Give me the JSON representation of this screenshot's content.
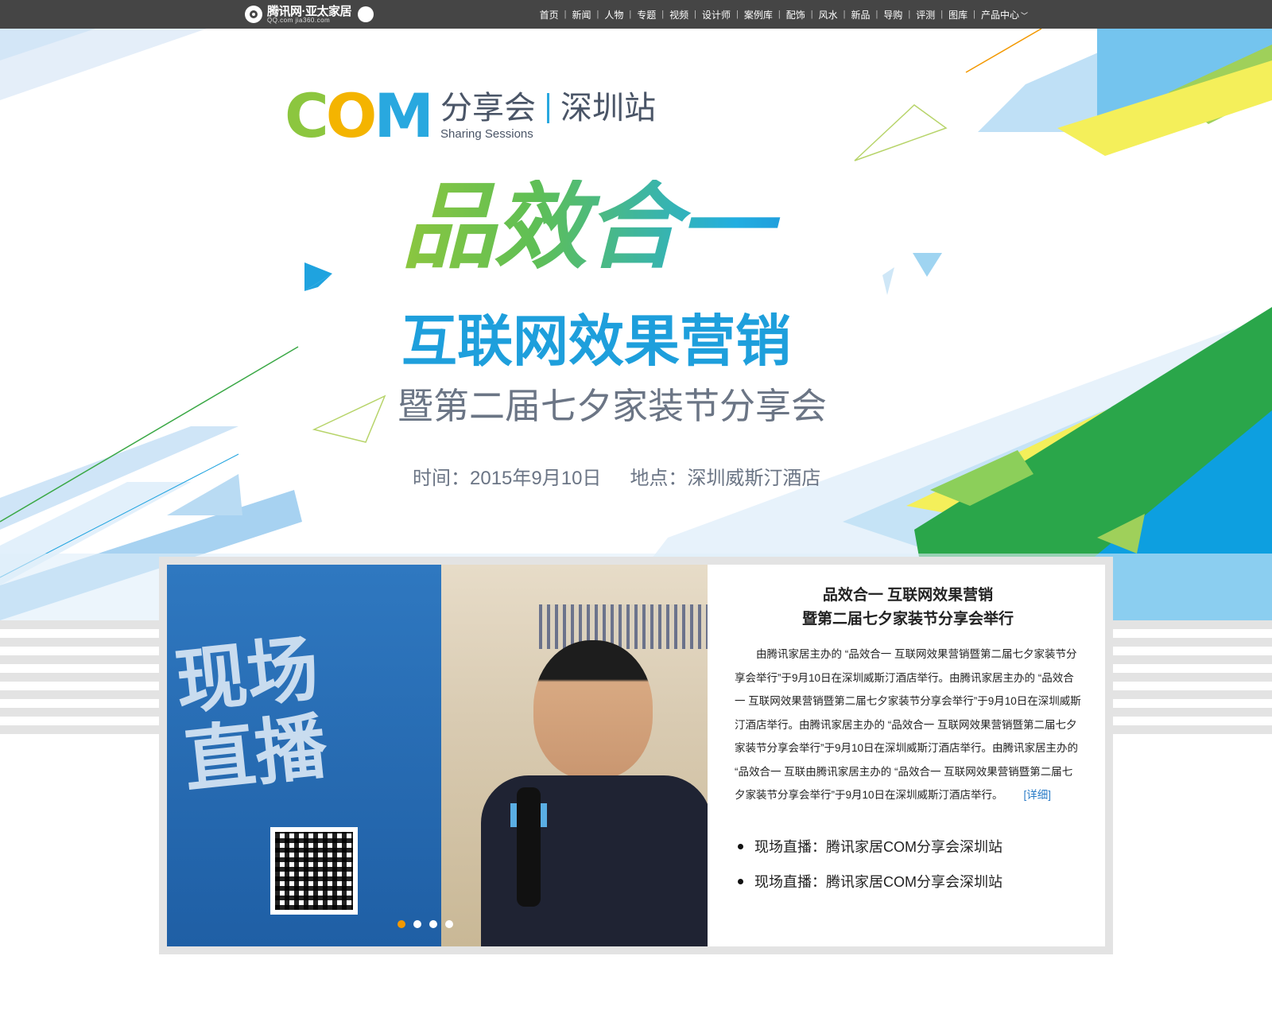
{
  "topbar": {
    "logo_main": "腾讯网·亚太家居",
    "logo_sub": "QQ.com  jia360.com",
    "nav": [
      "首页",
      "新闻",
      "人物",
      "专题",
      "视频",
      "设计师",
      "案例库",
      "配饰",
      "风水",
      "新品",
      "导购",
      "评测",
      "图库",
      "产品中心"
    ],
    "caret": "﹀"
  },
  "banner": {
    "com_letters": [
      "C",
      "O",
      "M"
    ],
    "com_title": "分享会",
    "com_city": "深圳站",
    "com_subtitle": "Sharing Sessions",
    "headline": "品效合一",
    "headline2": "互联网效果营销",
    "headline3": "暨第二届七夕家装节分享会",
    "time": "时间：2015年9月10日",
    "place": "地点：深圳威斯汀酒店"
  },
  "photo": {
    "panel_text_1": "现场",
    "panel_text_2": "直播",
    "dots": 4,
    "active_dot": 0
  },
  "article": {
    "title_line1": "品效合一 互联网效果营销",
    "title_line2": "暨第二届七夕家装节分享会举行",
    "body": "由腾讯家居主办的 “品效合一 互联网效果营销暨第二届七夕家装节分享会举行”于9月10日在深圳威斯汀酒店举行。由腾讯家居主办的 “品效合一 互联网效果营销暨第二届七夕家装节分享会举行”于9月10日在深圳威斯汀酒店举行。由腾讯家居主办的 “品效合一 互联网效果营销暨第二届七夕家装节分享会举行”于9月10日在深圳威斯汀酒店举行。由腾讯家居主办的 “品效合一 互联由腾讯家居主办的 “品效合一 互联网效果营销暨第二届七夕家装节分享会举行”于9月10日在深圳威斯汀酒店举行。",
    "more_label": "[详细]",
    "links": [
      "现场直播：腾讯家居COM分享会深圳站",
      "现场直播：腾讯家居COM分享会深圳站"
    ]
  },
  "colors": {
    "topbar": "#454545",
    "accent_blue": "#1e9fdc",
    "accent_green": "#8cc63f",
    "accent_yellow": "#f4b400",
    "active_dot": "#f39800",
    "link": "#2a7cc7"
  }
}
